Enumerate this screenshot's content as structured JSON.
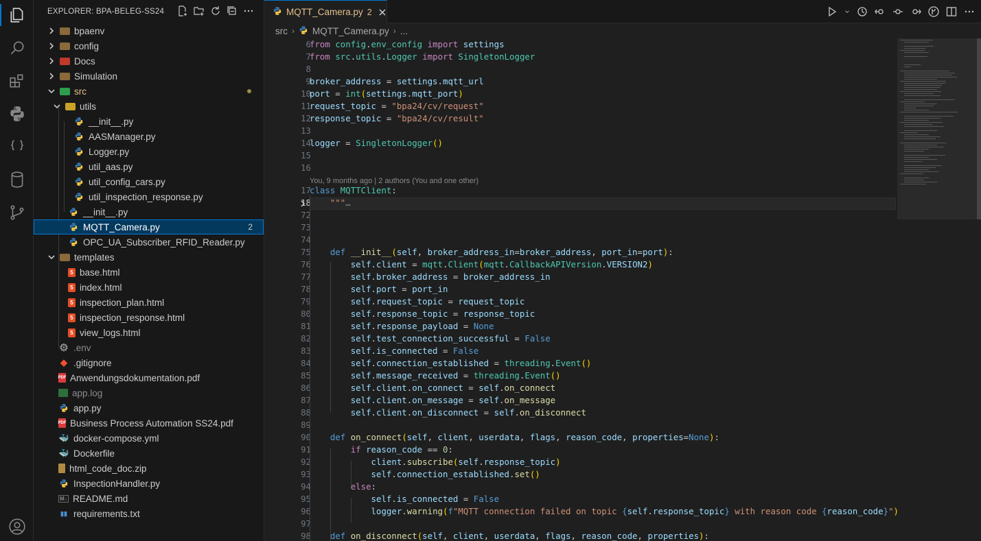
{
  "explorer": {
    "title": "EXPLORER: BPA-BELEG-SS24",
    "items": [
      {
        "label": "bpaenv",
        "type": "folder",
        "depth": 0,
        "expanded": false
      },
      {
        "label": "config",
        "type": "folder",
        "depth": 0,
        "expanded": false
      },
      {
        "label": "Docs",
        "type": "folder",
        "depth": 0,
        "expanded": false
      },
      {
        "label": "Simulation",
        "type": "folder",
        "depth": 0,
        "expanded": false
      },
      {
        "label": "src",
        "type": "folder",
        "depth": 0,
        "expanded": true,
        "modified": true
      },
      {
        "label": "utils",
        "type": "folder",
        "depth": 1,
        "expanded": true
      },
      {
        "label": "__init__.py",
        "type": "py",
        "depth": 2
      },
      {
        "label": "AASManager.py",
        "type": "py",
        "depth": 2
      },
      {
        "label": "Logger.py",
        "type": "py",
        "depth": 2
      },
      {
        "label": "util_aas.py",
        "type": "py",
        "depth": 2
      },
      {
        "label": "util_config_cars.py",
        "type": "py",
        "depth": 2
      },
      {
        "label": "util_inspection_response.py",
        "type": "py",
        "depth": 2
      },
      {
        "label": "__init__.py",
        "type": "py",
        "depth": 1
      },
      {
        "label": "MQTT_Camera.py",
        "type": "py",
        "depth": 1,
        "selected": true,
        "badge": "2"
      },
      {
        "label": "OPC_UA_Subscriber_RFID_Reader.py",
        "type": "py",
        "depth": 1
      },
      {
        "label": "templates",
        "type": "folder",
        "depth": 0,
        "expanded": true
      },
      {
        "label": "base.html",
        "type": "html",
        "depth": 1
      },
      {
        "label": "index.html",
        "type": "html",
        "depth": 1
      },
      {
        "label": "inspection_plan.html",
        "type": "html",
        "depth": 1
      },
      {
        "label": "inspection_response.html",
        "type": "html",
        "depth": 1
      },
      {
        "label": "view_logs.html",
        "type": "html",
        "depth": 1
      },
      {
        "label": ".env",
        "type": "gear",
        "depth": 0,
        "muted": true
      },
      {
        "label": ".gitignore",
        "type": "git",
        "depth": 0
      },
      {
        "label": "Anwendungsdokumentation.pdf",
        "type": "pdf",
        "depth": 0
      },
      {
        "label": "app.log",
        "type": "log",
        "depth": 0,
        "muted": true
      },
      {
        "label": "app.py",
        "type": "py",
        "depth": 0
      },
      {
        "label": "Business Process Automation SS24.pdf",
        "type": "pdf",
        "depth": 0
      },
      {
        "label": "docker-compose.yml",
        "type": "docker",
        "depth": 0
      },
      {
        "label": "Dockerfile",
        "type": "docker",
        "depth": 0
      },
      {
        "label": "html_code_doc.zip",
        "type": "zip",
        "depth": 0
      },
      {
        "label": "InspectionHandler.py",
        "type": "py",
        "depth": 0
      },
      {
        "label": "README.md",
        "type": "md",
        "depth": 0
      },
      {
        "label": "requirements.txt",
        "type": "txt",
        "depth": 0
      }
    ]
  },
  "tab": {
    "name": "MQTT_Camera.py",
    "problems": "2"
  },
  "breadcrumb": {
    "folder": "src",
    "file": "MQTT_Camera.py",
    "more": "..."
  },
  "blame": "You, 9 months ago | 2 authors (You and one other)",
  "code": [
    {
      "n": "6",
      "html": "<span class='k'>from</span> <span class='c'>config</span>.<span class='c'>env_config</span> <span class='k'>import</span> <span class='v'>settings</span>"
    },
    {
      "n": "7",
      "html": "<span class='k'>from</span> <span class='c'>src</span>.<span class='c'>utils</span>.<span class='c'>Logger</span> <span class='k'>import</span> <span class='c'>SingletonLogger</span>"
    },
    {
      "n": "8",
      "html": ""
    },
    {
      "n": "9",
      "html": "<span class='v'>broker_address</span> = <span class='v'>settings</span>.<span class='v'>mqtt_url</span>"
    },
    {
      "n": "10",
      "html": "<span class='v'>port</span> = <span class='c'>int</span><span class='p'>(</span><span class='v'>settings</span>.<span class='v'>mqtt_port</span><span class='p'>)</span>"
    },
    {
      "n": "11",
      "html": "<span class='v'>request_topic</span> = <span class='s'>\"bpa24/cv/request\"</span>"
    },
    {
      "n": "12",
      "html": "<span class='v'>response_topic</span> = <span class='s'>\"bpa24/cv/result\"</span>"
    },
    {
      "n": "13",
      "html": ""
    },
    {
      "n": "14",
      "html": "<span class='v'>logger</span> = <span class='c'>SingletonLogger</span><span class='p'>()</span>"
    },
    {
      "n": "15",
      "html": ""
    },
    {
      "n": "16",
      "html": ""
    },
    {
      "n": "17",
      "html": "<span class='kb'>class</span> <span class='c'>MQTTClient</span>:"
    },
    {
      "n": "18",
      "html": "    <span class='s'>\"\"\"</span><span style='color:#8b8b8b'>…</span>"
    },
    {
      "n": "72",
      "html": ""
    },
    {
      "n": "73",
      "html": ""
    },
    {
      "n": "74",
      "html": ""
    },
    {
      "n": "75",
      "html": "    <span class='kb'>def</span> <span class='f'>__init__</span><span class='p'>(</span><span class='v'>self</span>, <span class='v'>broker_address_in</span>=<span class='v'>broker_address</span>, <span class='v'>port_in</span>=<span class='v'>port</span><span class='p'>)</span>:"
    },
    {
      "n": "76",
      "html": "        <span class='v'>self</span>.<span class='v'>client</span> = <span class='c'>mqtt</span>.<span class='c'>Client</span><span class='p'>(</span><span class='c'>mqtt</span>.<span class='c'>CallbackAPIVersion</span>.<span class='v'>VERSION2</span><span class='p'>)</span>"
    },
    {
      "n": "77",
      "html": "        <span class='v'>self</span>.<span class='v'>broker_address</span> = <span class='v'>broker_address_in</span>"
    },
    {
      "n": "78",
      "html": "        <span class='v'>self</span>.<span class='v'>port</span> = <span class='v'>port_in</span>"
    },
    {
      "n": "79",
      "html": "        <span class='v'>self</span>.<span class='v'>request_topic</span> = <span class='v'>request_topic</span>"
    },
    {
      "n": "80",
      "html": "        <span class='v'>self</span>.<span class='v'>response_topic</span> = <span class='v'>response_topic</span>"
    },
    {
      "n": "81",
      "html": "        <span class='v'>self</span>.<span class='v'>response_payload</span> = <span class='kb'>None</span>"
    },
    {
      "n": "82",
      "html": "        <span class='v'>self</span>.<span class='v'>test_connection_successful</span> = <span class='kb'>False</span>"
    },
    {
      "n": "83",
      "html": "        <span class='v'>self</span>.<span class='v'>is_connected</span> = <span class='kb'>False</span>"
    },
    {
      "n": "84",
      "html": "        <span class='v'>self</span>.<span class='v'>connection_established</span> = <span class='c'>threading</span>.<span class='c'>Event</span><span class='p'>()</span>"
    },
    {
      "n": "85",
      "html": "        <span class='v'>self</span>.<span class='v'>message_received</span> = <span class='c'>threading</span>.<span class='c'>Event</span><span class='p'>()</span>"
    },
    {
      "n": "86",
      "html": "        <span class='v'>self</span>.<span class='v'>client</span>.<span class='v'>on_connect</span> = <span class='v'>self</span>.<span class='f'>on_connect</span>"
    },
    {
      "n": "87",
      "html": "        <span class='v'>self</span>.<span class='v'>client</span>.<span class='v'>on_message</span> = <span class='v'>self</span>.<span class='f'>on_message</span>"
    },
    {
      "n": "88",
      "html": "        <span class='v'>self</span>.<span class='v'>client</span>.<span class='v'>on_disconnect</span> = <span class='v'>self</span>.<span class='f'>on_disconnect</span>"
    },
    {
      "n": "89",
      "html": ""
    },
    {
      "n": "90",
      "html": "    <span class='kb'>def</span> <span class='f'>on_connect</span><span class='p'>(</span><span class='v'>self</span>, <span class='v'>client</span>, <span class='v'>userdata</span>, <span class='v'>flags</span>, <span class='v'>reason_code</span>, <span class='v'>properties</span>=<span class='kb'>None</span><span class='p'>)</span>:"
    },
    {
      "n": "91",
      "html": "        <span class='k'>if</span> <span class='v'>reason_code</span> == <span class='n'>0</span>:"
    },
    {
      "n": "92",
      "html": "            <span class='v'>client</span>.<span class='f'>subscribe</span><span class='p'>(</span><span class='v'>self</span>.<span class='v'>response_topic</span><span class='p'>)</span>"
    },
    {
      "n": "93",
      "html": "            <span class='v'>self</span>.<span class='v'>connection_established</span>.<span class='f'>set</span><span class='p'>()</span>"
    },
    {
      "n": "94",
      "html": "        <span class='k'>else</span>:"
    },
    {
      "n": "95",
      "html": "            <span class='v'>self</span>.<span class='v'>is_connected</span> = <span class='kb'>False</span>"
    },
    {
      "n": "96",
      "html": "            <span class='v'>logger</span>.<span class='f'>warning</span><span class='p'>(</span><span class='kb'>f</span><span class='s'>\"MQTT connection failed on topic </span><span class='kb'>{</span><span class='v'>self</span>.<span class='v'>response_topic</span><span class='kb'>}</span><span class='s'> with reason code </span><span class='kb'>{</span><span class='v'>reason_code</span><span class='kb'>}</span><span class='s'>\"</span><span class='p'>)</span>"
    },
    {
      "n": "97",
      "html": ""
    },
    {
      "n": "98",
      "html": "    <span class='kb'>def</span> <span class='f'>on_disconnect</span><span class='p'>(</span><span class='v'>self</span>, <span class='v'>client</span>, <span class='v'>userdata</span>, <span class='v'>flags</span>, <span class='v'>reason_code</span>, <span class='v'>properties</span><span class='p'>)</span>:"
    }
  ]
}
